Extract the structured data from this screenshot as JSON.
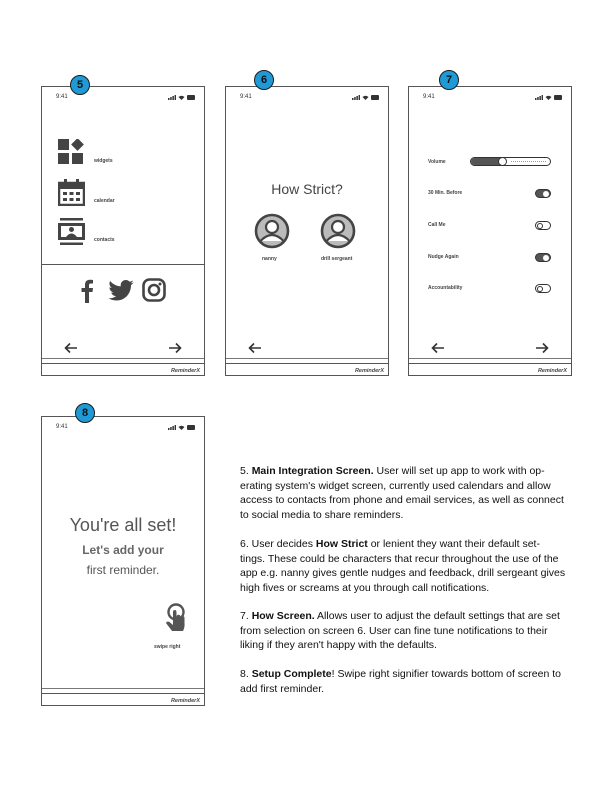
{
  "common": {
    "time": "9:41",
    "brand": "ReminderX"
  },
  "screen5": {
    "badge": "5",
    "items": [
      {
        "label": "widgets",
        "icon": "widgets-icon"
      },
      {
        "label": "calendar",
        "icon": "calendar-icon"
      },
      {
        "label": "contacts",
        "icon": "contacts-icon"
      }
    ],
    "social": [
      "facebook-icon",
      "twitter-icon",
      "instagram-icon"
    ]
  },
  "screen6": {
    "badge": "6",
    "title": "How Strict?",
    "options": [
      {
        "label": "nanny"
      },
      {
        "label": "drill sergeant"
      }
    ]
  },
  "screen7": {
    "badge": "7",
    "volume_label": "Volume",
    "volume_level": 0.4,
    "settings": [
      {
        "label": "30 Min. Before",
        "on": true
      },
      {
        "label": "Call Me",
        "on": false
      },
      {
        "label": "Nudge Again",
        "on": true
      },
      {
        "label": "Accountability",
        "on": false
      }
    ]
  },
  "screen8": {
    "badge": "8",
    "headline": "You're all set!",
    "subline1": "Let's add your",
    "subline2": "first reminder.",
    "gesture_label": "swipe right"
  },
  "descriptions": {
    "d5_num": "5.",
    "d5_title": "Main Integration Screen.",
    "d5_l1": " User will set up app to work with op-",
    "d5_l2": "erating system's widget screen, currently used calendars and allow",
    "d5_l3": "access to contacts from phone and email services, as well as connect",
    "d5_l4": "to social media to share reminders.",
    "d6_pre": "6. User decides ",
    "d6_title": "How Strict",
    "d6_l1": " or lenient they want their default set-",
    "d6_l2": "tings. These could be characters that recur throughout the use of the",
    "d6_l3": "app e.g. nanny gives gentle nudges and feedback, drill sergeant gives",
    "d6_l4": "high fives or screams at you through call notifications.",
    "d7_num": "7.",
    "d7_title": "How Screen.",
    "d7_l1": " Allows user to adjust the default settings that are set",
    "d7_l2": "from selection on screen 6. User can fine tune notifications to their",
    "d7_l3": "liking if they aren't happy with the defaults.",
    "d8_num": "8.",
    "d8_title": "Setup Complete",
    "d8_l1": "! Swipe right signifier towards bottom of screen to",
    "d8_l2": "add first reminder."
  }
}
